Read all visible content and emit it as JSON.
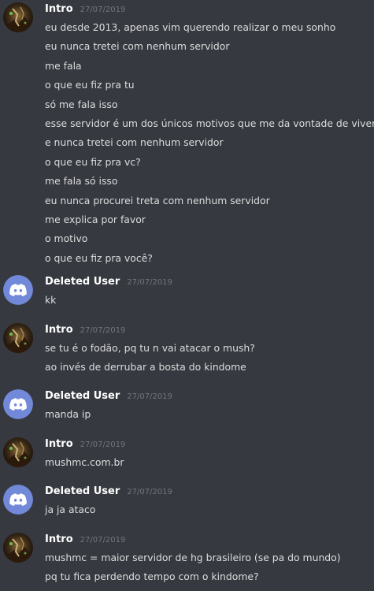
{
  "colors": {
    "background": "#36393f",
    "username": "#ffffff",
    "timestamp": "#72767d",
    "message_text": "#dcddde",
    "discord_avatar": "#7289da"
  },
  "messages": [
    {
      "author": "Intro",
      "timestamp": "27/07/2019",
      "avatar": "intro-avatar",
      "lines": [
        "eu desde 2013, apenas vim querendo realizar o meu sonho",
        "eu nunca tretei com nenhum servidor",
        "me fala",
        "o que eu fiz pra tu",
        "só me fala isso",
        "esse servidor é um dos únicos motivos que me da vontade de viver",
        "e nunca tretei com nenhum servidor",
        "o que eu fiz pra vc?",
        "me fala só isso",
        "eu nunca procurei treta com nenhum servidor",
        "me explica por favor",
        "o motivo",
        "o que eu fiz pra você?"
      ]
    },
    {
      "author": "Deleted User",
      "timestamp": "27/07/2019",
      "avatar": "discord-logo-icon",
      "lines": [
        "kk"
      ]
    },
    {
      "author": "Intro",
      "timestamp": "27/07/2019",
      "avatar": "intro-avatar",
      "lines": [
        "se tu é o fodão, pq tu n vai atacar o mush?",
        "ao invés de derrubar a bosta do kindome"
      ]
    },
    {
      "author": "Deleted User",
      "timestamp": "27/07/2019",
      "avatar": "discord-logo-icon",
      "lines": [
        "manda ip"
      ]
    },
    {
      "author": "Intro",
      "timestamp": "27/07/2019",
      "avatar": "intro-avatar",
      "lines": [
        "mushmc.com.br"
      ]
    },
    {
      "author": "Deleted User",
      "timestamp": "27/07/2019",
      "avatar": "discord-logo-icon",
      "lines": [
        "ja ja ataco"
      ]
    },
    {
      "author": "Intro",
      "timestamp": "27/07/2019",
      "avatar": "intro-avatar",
      "lines": [
        "mushmc = maior servidor de hg brasileiro (se pa do mundo)",
        "pq tu fica perdendo tempo com o kindome?"
      ]
    }
  ]
}
